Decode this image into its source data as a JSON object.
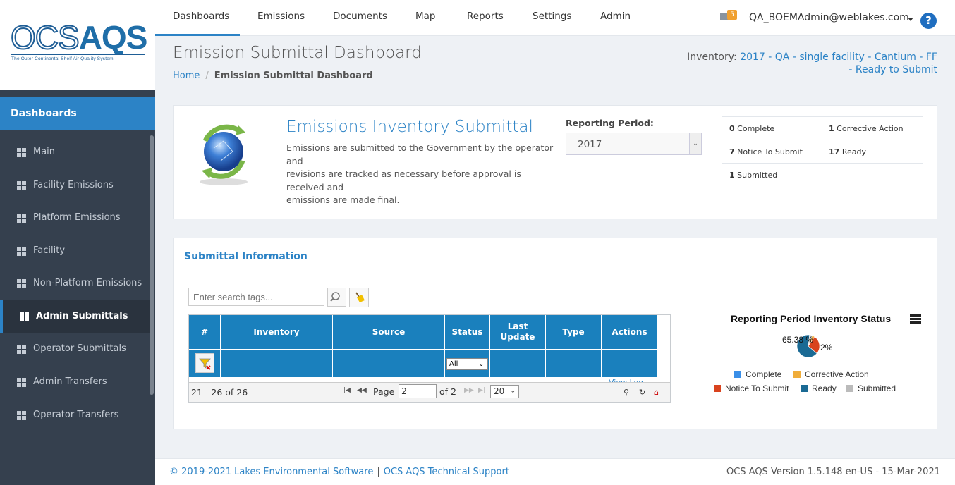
{
  "logo": {
    "ocs": "OCS",
    "aqs": "AQS",
    "tagline": "The Outer Continental Shelf Air Quality System"
  },
  "sidebar": {
    "heading": "Dashboards",
    "items": [
      {
        "label": "Main"
      },
      {
        "label": "Facility Emissions"
      },
      {
        "label": "Platform Emissions"
      },
      {
        "label": "Facility"
      },
      {
        "label": "Non-Platform Emissions"
      },
      {
        "label": "Admin Submittals"
      },
      {
        "label": "Operator Submittals"
      },
      {
        "label": "Admin Transfers"
      },
      {
        "label": "Operator Transfers"
      }
    ]
  },
  "topnav": {
    "items": [
      "Dashboards",
      "Emissions",
      "Documents",
      "Map",
      "Reports",
      "Settings",
      "Admin"
    ],
    "mail_count": "5",
    "user": "QA_BOEMAdmin@weblakes.com",
    "help": "?"
  },
  "page": {
    "title": "Emission Submittal Dashboard",
    "breadcrumb_home": "Home",
    "breadcrumb_sep": "/",
    "breadcrumb_current": "Emission Submittal Dashboard",
    "inventory_label": "Inventory:",
    "inventory_value": "2017 - QA - single facility - Cantium - FF - Ready to Submit"
  },
  "summary": {
    "title": "Emissions Inventory Submittal",
    "desc_lines": [
      "Emissions are submitted to the Government by the operator",
      "and",
      "revisions are tracked as necessary before approval is",
      "received and",
      "emissions are made final."
    ],
    "reporting_period_label": "Reporting Period:",
    "reporting_period_value": "2017",
    "statuses": [
      {
        "count": "0",
        "label": "Complete"
      },
      {
        "count": "1",
        "label": "Corrective Action"
      },
      {
        "count": "7",
        "label": "Notice To Submit"
      },
      {
        "count": "17",
        "label": "Ready"
      },
      {
        "count": "1",
        "label": "Submitted"
      }
    ]
  },
  "submittal": {
    "title": "Submittal Information",
    "search_placeholder": "Enter search tags...",
    "columns": [
      "#",
      "Inventory",
      "Source",
      "Status",
      "Last Update",
      "Type",
      "Actions"
    ],
    "status_filter": "All",
    "view_log": "View Log",
    "pager": {
      "info": "21 - 26 of 26",
      "page_label": "Page",
      "page_value": "2",
      "of": "of 2",
      "page_size": "20"
    }
  },
  "chart_data": {
    "type": "pie",
    "title": "Reporting Period Inventory Status",
    "categories": [
      "Complete",
      "Corrective Action",
      "Notice To Submit",
      "Ready",
      "Submitted"
    ],
    "values": [
      0,
      1,
      7,
      17,
      1
    ],
    "colors": [
      "#3a8fe8",
      "#f0ad3a",
      "#d9431e",
      "#1a6a94",
      "#bbbbbb"
    ],
    "data_labels": [
      "65.38 %",
      "2%"
    ],
    "legend_position": "bottom"
  },
  "footer": {
    "copyright": "© 2019-2021 Lakes Environmental Software",
    "separator": "|",
    "support": "OCS AQS Technical Support",
    "version": "OCS AQS Version 1.5.148 en-US - 15-Mar-2021"
  }
}
